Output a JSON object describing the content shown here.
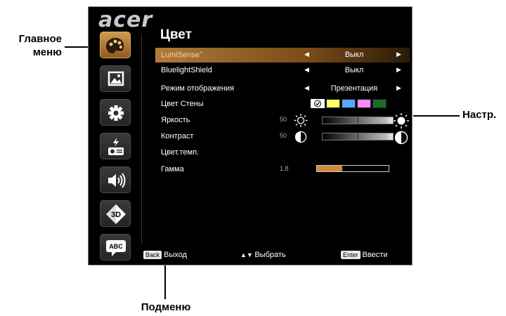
{
  "brand": "acer",
  "callouts": {
    "main_menu": "Главное меню",
    "adjust": "Настр.",
    "submenu": "Подменю"
  },
  "sidebar": {
    "items": [
      {
        "icon": "palette-icon",
        "active": true
      },
      {
        "icon": "picture-icon"
      },
      {
        "icon": "gear-icon"
      },
      {
        "icon": "power-management-icon"
      },
      {
        "icon": "speaker-icon"
      },
      {
        "icon": "3d-icon",
        "badge": "3D"
      },
      {
        "icon": "language-icon",
        "badge": "ABC"
      }
    ]
  },
  "menu": {
    "title": "Цвет",
    "rows": [
      {
        "label": "LumiSense",
        "sup": "+",
        "value": "Выкл",
        "selected": true
      },
      {
        "label": "BluelightShield",
        "value": "Выкл"
      },
      {
        "label": "Режим отображения",
        "value": "Презентация"
      },
      {
        "label": "Цвет Стены",
        "swatches": [
          "#ffff66",
          "#55aaff",
          "#ff88ff",
          "#1d6b2a"
        ]
      },
      {
        "label": "Яркость",
        "value_num": "50",
        "level": 0.5
      },
      {
        "label": "Контраст",
        "value_num": "50",
        "level": 0.5
      },
      {
        "label": "Цвет.темп."
      },
      {
        "label": "Гамма",
        "value_num": "1.8",
        "level": 0.35
      }
    ]
  },
  "footer": {
    "back_key": "Back",
    "back_label": "Выход",
    "select_label": "Выбрать",
    "enter_key": "Enter",
    "enter_label": "Ввести"
  },
  "colors": {
    "accent": "#c08a4a",
    "background": "#000000"
  }
}
